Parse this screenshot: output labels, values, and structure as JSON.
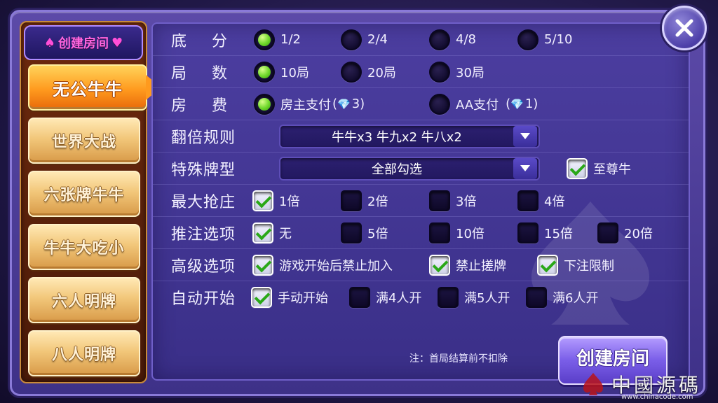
{
  "header": {
    "title": "创建房间",
    "title_suit_left": "♠",
    "title_suit_right": "♥"
  },
  "game_modes": [
    {
      "label": "无公牛牛",
      "active": true
    },
    {
      "label": "世界大战",
      "active": false
    },
    {
      "label": "六张牌牛牛",
      "active": false
    },
    {
      "label": "牛牛大吃小",
      "active": false
    },
    {
      "label": "六人明牌",
      "active": false
    },
    {
      "label": "八人明牌",
      "active": false
    }
  ],
  "settings": {
    "base_score": {
      "label": "底分",
      "options": [
        {
          "label": "1/2",
          "selected": true
        },
        {
          "label": "2/4",
          "selected": false
        },
        {
          "label": "4/8",
          "selected": false
        },
        {
          "label": "5/10",
          "selected": false
        }
      ]
    },
    "rounds": {
      "label": "局数",
      "options": [
        {
          "label": "10局",
          "selected": true
        },
        {
          "label": "20局",
          "selected": false
        },
        {
          "label": "30局",
          "selected": false
        }
      ]
    },
    "room_fee": {
      "label": "房费",
      "options": [
        {
          "label": "房主支付",
          "cost_prefix": "(",
          "cost": "3)",
          "selected": true
        },
        {
          "label": "AA支付",
          "cost_prefix": "(",
          "cost": "1)",
          "selected": false
        }
      ]
    },
    "multiplier_rule": {
      "label": "翻倍规则",
      "value": "牛牛x3 牛九x2 牛八x2"
    },
    "special_hands": {
      "label": "特殊牌型",
      "value": "全部勾选",
      "extra_label": "至尊牛",
      "extra_checked": true
    },
    "max_banker_bid": {
      "label": "最大抢庄",
      "options": [
        {
          "label": "1倍",
          "checked": true
        },
        {
          "label": "2倍",
          "checked": false
        },
        {
          "label": "3倍",
          "checked": false
        },
        {
          "label": "4倍",
          "checked": false
        }
      ]
    },
    "push_bet": {
      "label": "推注选项",
      "options": [
        {
          "label": "无",
          "checked": true
        },
        {
          "label": "5倍",
          "checked": false
        },
        {
          "label": "10倍",
          "checked": false
        },
        {
          "label": "15倍",
          "checked": false
        },
        {
          "label": "20倍",
          "checked": false
        }
      ]
    },
    "advanced": {
      "label": "高级选项",
      "options": [
        {
          "label": "游戏开始后禁止加入",
          "checked": true
        },
        {
          "label": "禁止搓牌",
          "checked": true
        },
        {
          "label": "下注限制",
          "checked": true
        }
      ]
    },
    "auto_start": {
      "label": "自动开始",
      "options": [
        {
          "label": "手动开始",
          "checked": true
        },
        {
          "label": "满4人开",
          "checked": false
        },
        {
          "label": "满5人开",
          "checked": false
        },
        {
          "label": "满6人开",
          "checked": false
        }
      ]
    }
  },
  "footer": {
    "note": "注：首局结算前不扣除",
    "create_button": "创建房间"
  },
  "watermark": {
    "text": "中國源碼",
    "url": "www.chinacode.com"
  },
  "colors": {
    "accent_green": "#6ed82a",
    "panel_purple": "#3e3188",
    "active_orange": "#ff9a1e",
    "gold_button": "#f2c77a"
  },
  "icons": {
    "close": "close-icon",
    "gem": "diamond-icon",
    "dropdown": "chevron-down-icon"
  }
}
